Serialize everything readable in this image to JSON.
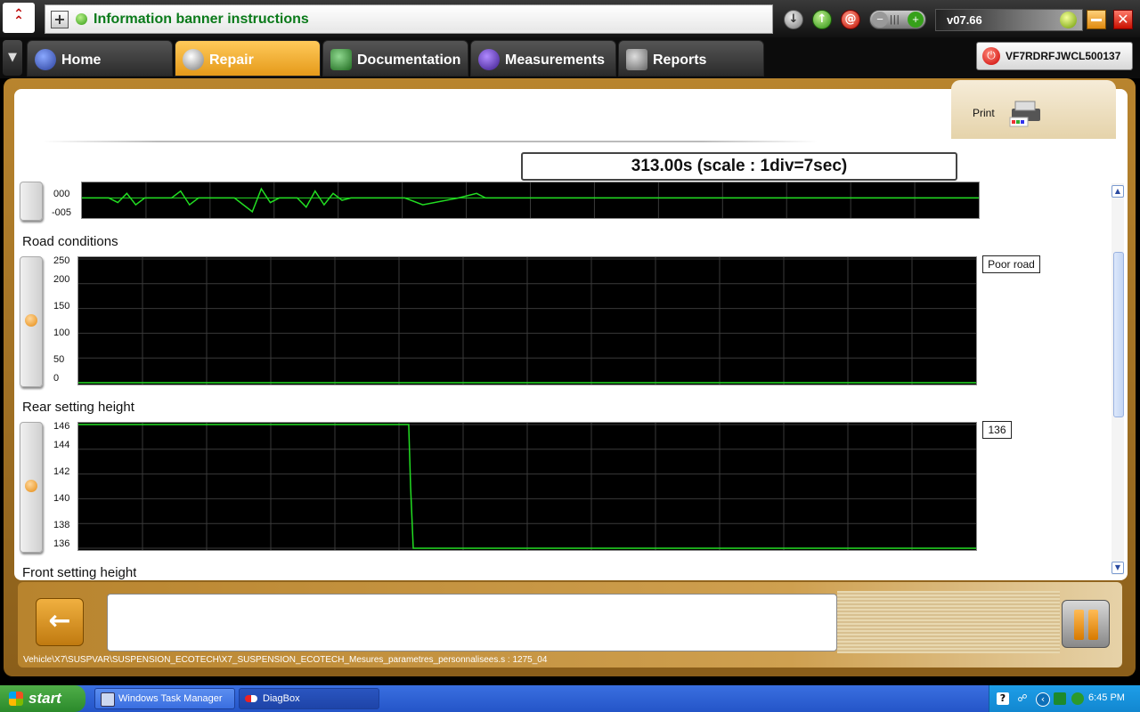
{
  "banner": {
    "text": "Information banner instructions"
  },
  "version": "v07.66",
  "tabs": [
    {
      "label": "Home"
    },
    {
      "label": "Repair"
    },
    {
      "label": "Documentation"
    },
    {
      "label": "Measurements"
    },
    {
      "label": "Reports"
    }
  ],
  "vin": "VF7RDRFJWCL500137",
  "print_label": "Print",
  "time_display": "313.00s (scale : 1div=7sec)",
  "charts": [
    {
      "title": "",
      "y_labels": [
        "000",
        "-005"
      ],
      "value": ""
    },
    {
      "title": "Road conditions",
      "y_labels": [
        "250",
        "200",
        "150",
        "100",
        "50",
        "0"
      ],
      "value": "Poor road"
    },
    {
      "title": "Rear setting height",
      "y_labels": [
        "146",
        "144",
        "142",
        "140",
        "138",
        "136"
      ],
      "value": "136"
    },
    {
      "title": "Front setting height",
      "y_labels": [],
      "value": ""
    }
  ],
  "chart_data": [
    {
      "type": "line",
      "title": "",
      "ylim": [
        -8,
        6
      ],
      "x": [
        0,
        3,
        4,
        5,
        6,
        7,
        10,
        11,
        12,
        13,
        17,
        19,
        20,
        21,
        22,
        23,
        24,
        25,
        26,
        27,
        28,
        29,
        30,
        31,
        36,
        38,
        42,
        44,
        45,
        46,
        100
      ],
      "series": [
        {
          "values": [
            0,
            0,
            -2,
            2,
            -3,
            0,
            0,
            3,
            -3,
            0,
            0,
            -6,
            4,
            -2,
            0,
            0,
            0,
            -4,
            3,
            -3,
            2,
            -1,
            0,
            0,
            0,
            -3,
            0,
            2,
            0,
            0,
            0
          ]
        }
      ],
      "grid": true
    },
    {
      "type": "line",
      "title": "Road conditions",
      "ylim": [
        0,
        250
      ],
      "yticks": [
        0,
        50,
        100,
        150,
        200,
        250
      ],
      "x": [
        0,
        100
      ],
      "series": [
        {
          "values": [
            0,
            0
          ]
        }
      ],
      "grid": true
    },
    {
      "type": "line",
      "title": "Rear setting height",
      "ylim": [
        136,
        146
      ],
      "yticks": [
        136,
        138,
        140,
        142,
        144,
        146
      ],
      "x": [
        0,
        36.8,
        37.0,
        37.3,
        100
      ],
      "series": [
        {
          "values": [
            146,
            146,
            141,
            136,
            136
          ]
        }
      ],
      "grid": true
    }
  ],
  "path": "Vehicle\\X7\\SUSPVAR\\SUSPENSION_ECOTECH\\X7_SUSPENSION_ECOTECH_Mesures_parametres_personnalisees.s : 1275_04",
  "taskbar": {
    "start": "start",
    "items": [
      {
        "label": "Windows Task Manager"
      },
      {
        "label": "DiagBox"
      }
    ],
    "clock": "6:45 PM"
  },
  "colors": {
    "accent": "#e59a1a",
    "trace": "#22dd22",
    "banner_text": "#0a7a1a"
  }
}
